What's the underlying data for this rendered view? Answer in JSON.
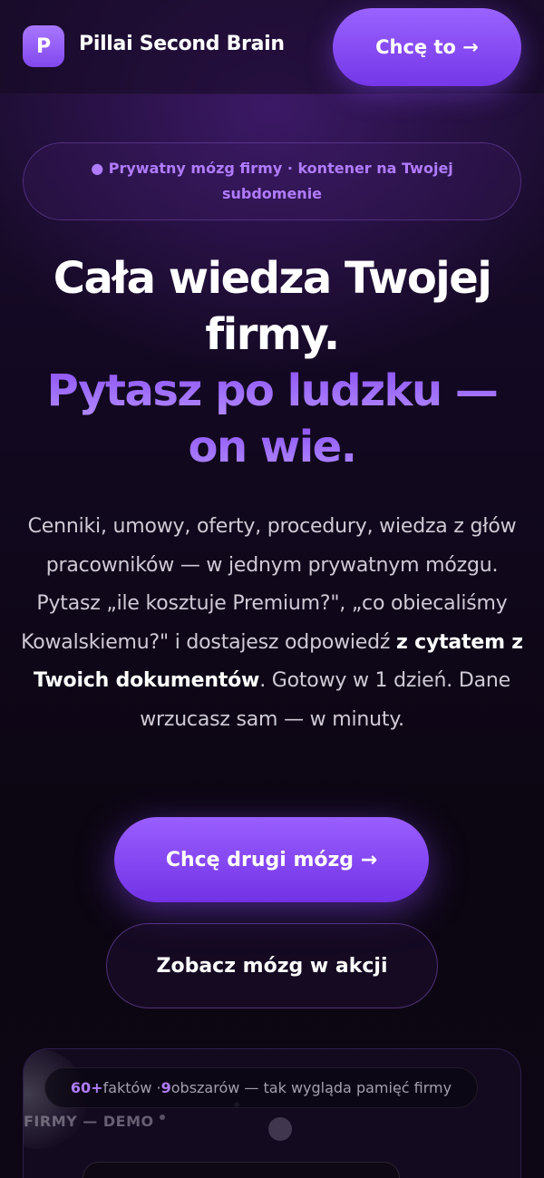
{
  "header": {
    "logo_letter": "P",
    "brand_name": "Pillai Second Brain",
    "cta_label": "Chcę to →"
  },
  "badge": {
    "text": "● Prywatny mózg firmy · kontener na Twojej subdomenie"
  },
  "headline": {
    "line1": "Cała wiedza Twojej",
    "line2": "firmy.",
    "line3": "Pytasz po ludzku —",
    "line4": "on wie."
  },
  "description": {
    "part1": "Cenniki, umowy, oferty, procedury, wiedza z głów pracowników — w jednym prywatnym mózgu. Pytasz „ile kosztuje Premium?\", „co obiecaliśmy Kowalskiemu?\" i dostajesz odpowiedź ",
    "bold": "z cytatem z Twoich dokumentów",
    "part2": ". Gotowy w 1 dzień. Dane wrzucasz sam — w minuty."
  },
  "buttons": {
    "primary_label": "Chcę drugi mózg →",
    "secondary_label": "Zobacz mózg w akcji"
  },
  "demo": {
    "facts_count": "60+",
    "facts_label": " faktów · ",
    "areas_count": "9",
    "areas_label": " obszarów — tak wygląda pamięć firmy",
    "faded_label": "FIRMY — DEMO"
  },
  "colors": {
    "accent": "#8b4ef5",
    "accent_light": "#b07cff",
    "background": "#0d0614"
  }
}
